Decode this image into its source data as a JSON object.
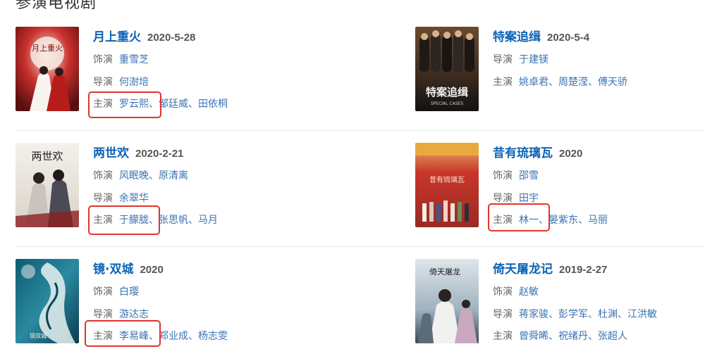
{
  "section": {
    "title": "参演电视剧"
  },
  "labels": {
    "role": "饰演",
    "director": "导演",
    "cast": "主演"
  },
  "colors": {
    "title": "#0b63b6",
    "link": "#3a73b3",
    "highlight": "#e0342f"
  },
  "shows": [
    {
      "title": "月上重火",
      "date": "2020-5-28",
      "poster_text": "月上重火",
      "role": [
        "重雪芝"
      ],
      "director": [
        "何澍培"
      ],
      "cast": [
        "罗云熙",
        "邹廷威",
        "田依桐"
      ],
      "highlight": true
    },
    {
      "title": "特案追缉",
      "date": "2020-5-4",
      "poster_text": "特案追缉",
      "poster_subtext": "SPECIAL CASES",
      "role": [],
      "director": [
        "于建镁"
      ],
      "cast": [
        "姚卓君",
        "周楚滢",
        "傅天骄"
      ],
      "highlight": false
    },
    {
      "title": "两世欢",
      "date": "2020-2-21",
      "poster_text": "两世欢",
      "role": [
        "风眠晚",
        "原清离"
      ],
      "director": [
        "余翠华"
      ],
      "cast": [
        "于朦胧",
        "张思帆",
        "马月"
      ],
      "highlight": true
    },
    {
      "title": "昔有琉璃瓦",
      "date": "2020",
      "poster_text": "昔有琉璃瓦",
      "role": [
        "邵雪"
      ],
      "director": [
        "田宇"
      ],
      "cast": [
        "林一",
        "晏紫东",
        "马丽"
      ],
      "highlight": true
    },
    {
      "title": "镜·双城",
      "date": "2020",
      "poster_text": "镜双城",
      "role": [
        "白璎"
      ],
      "director": [
        "游达志"
      ],
      "cast": [
        "李易峰",
        "郑业成",
        "杨志雯"
      ],
      "highlight": true
    },
    {
      "title": "倚天屠龙记",
      "date": "2019-2-27",
      "poster_text": "倚天屠龙",
      "role": [
        "赵敏"
      ],
      "director": [
        "蒋家骏",
        "彭学军",
        "杜渊",
        "江洪敏"
      ],
      "cast": [
        "曾舜晞",
        "祝绪丹",
        "张超人"
      ],
      "highlight": false
    }
  ]
}
